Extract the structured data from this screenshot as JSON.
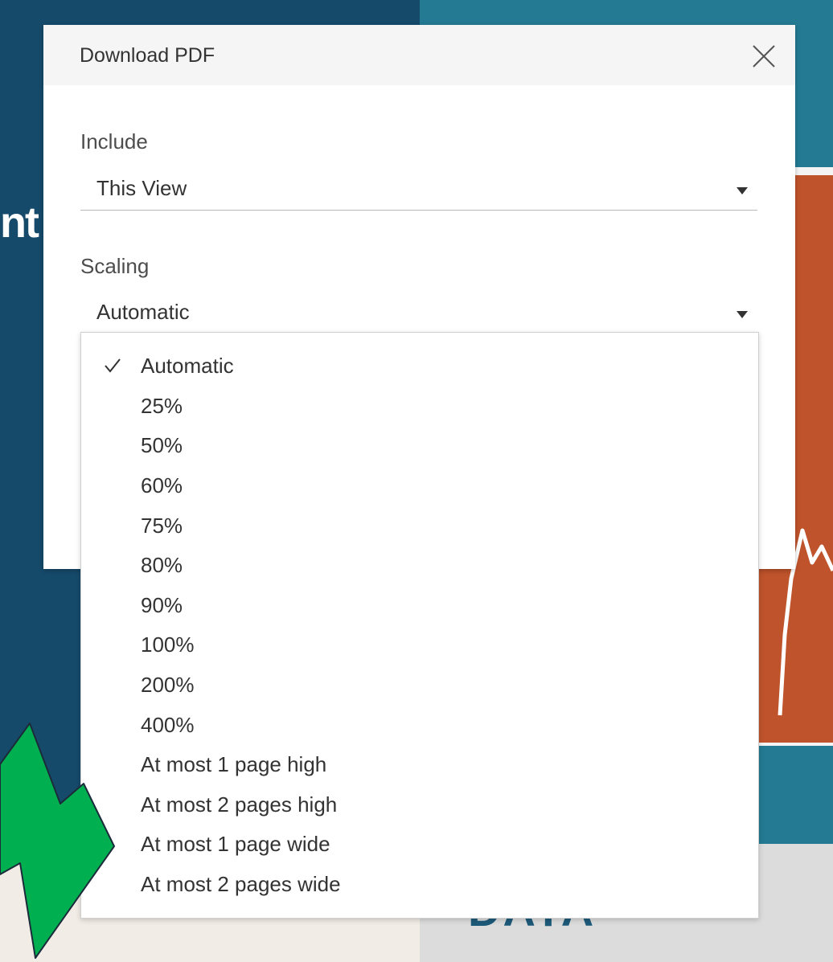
{
  "dialog": {
    "title": "Download PDF",
    "close_icon": "close-icon",
    "include": {
      "label": "Include",
      "value": "This View"
    },
    "scaling": {
      "label": "Scaling",
      "value": "Automatic",
      "options": [
        "Automatic",
        "25%",
        "50%",
        "60%",
        "75%",
        "80%",
        "90%",
        "100%",
        "200%",
        "400%",
        "At most 1 page high",
        "At most 2 pages high",
        "At most 1 page wide",
        "At most 2 pages wide"
      ],
      "selected_index": 0
    }
  },
  "background": {
    "fragment_text": "nt",
    "data_word": "DATA"
  },
  "colors": {
    "arrow": "#00b050",
    "dark_blue": "#164a6b",
    "teal": "#237a92",
    "orange": "#bf532b"
  }
}
